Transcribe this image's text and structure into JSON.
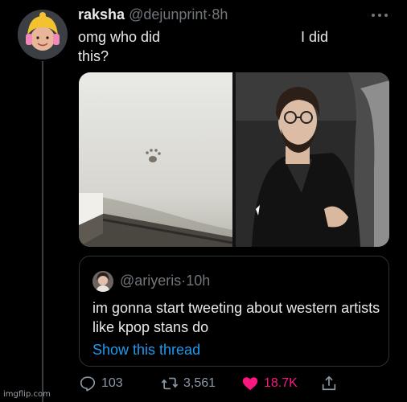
{
  "tweet": {
    "display_name": "raksha",
    "handle": "@dejunprint",
    "separator": "·",
    "time": "8h",
    "text_line1": "omg who did",
    "text_line2": "this?",
    "right_text": "I did"
  },
  "quoted": {
    "handle": "@ariyeris",
    "separator": "·",
    "time": "10h",
    "text": "im gonna start tweeting about western artists like kpop stans do",
    "show_thread": "Show this thread"
  },
  "actions": {
    "replies": "103",
    "retweets": "3,561",
    "likes": "18.7K"
  },
  "watermark": "imgflip.com",
  "colors": {
    "background": "#000000",
    "text": "#e7e9ea",
    "muted": "#71767b",
    "link": "#1d9bf0",
    "like": "#f91880"
  },
  "icons": [
    "more-icon",
    "reply-icon",
    "retweet-icon",
    "heart-icon",
    "share-icon"
  ]
}
